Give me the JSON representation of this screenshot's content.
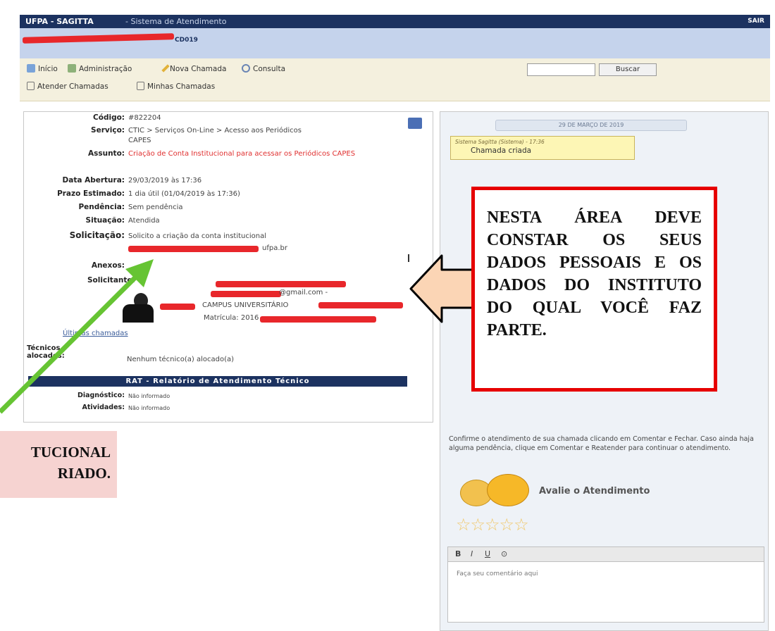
{
  "window": {
    "app_title": "UFPA - SAGITTA",
    "subtitle": "- Sistema de Atendimento",
    "right_label": "SAIR",
    "user_label": "CD019"
  },
  "toolbar": {
    "inicio": "Início",
    "administracao": "Administração",
    "nova_chamada": "Nova Chamada",
    "consulta": "Consulta",
    "atender_chamadas": "Atender Chamadas",
    "minhas_chamadas": "Minhas Chamadas",
    "search_value": "",
    "search_button": "Buscar"
  },
  "ticket": {
    "codigo_label": "Código:",
    "codigo_value": "#822204",
    "servico_label": "Serviço:",
    "servico_value": "CTIC > Serviços On-Line > Acesso aos Periódicos CAPES",
    "assunto_label": "Assunto:",
    "assunto_value": "Criação de Conta Institucional para acessar os Periódicos CAPES",
    "data_abertura_label": "Data Abertura:",
    "data_abertura_value": "29/03/2019 às 17:36",
    "prazo_label": "Prazo Estimado:",
    "prazo_value": "1 dia útil (01/04/2019 às 17:36)",
    "pendencia_label": "Pendência:",
    "pendencia_value": "Sem pendência",
    "situacao_label": "Situação:",
    "situacao_value": "Atendida",
    "solicitacao_label": "Solicitação:",
    "solicitacao_value": "Solicito a criação da conta institucional",
    "solicitacao_email_suffix": "ufpa.br",
    "anexos_label": "Anexos:",
    "solicitante_label": "Solicitante:",
    "solicitante_email_suffix": "@gmail.com -",
    "solicitante_campus": "CAMPUS UNIVERSITÁRIO",
    "solicitante_matricula": "Matrícula: 2016",
    "ultimas_chamadas": "Últimas chamadas",
    "tecnicos_label": "Técnicos alocados:",
    "tecnicos_value": "Nenhum técnico(a) alocado(a)",
    "rat_title": "RAT - Relatório de Atendimento Técnico",
    "diagnostico_label": "Diagnóstico:",
    "diagnostico_value": "Não informado",
    "atividades_label": "Atividades:",
    "atividades_value": "Não informado"
  },
  "history": {
    "date_button": "29 DE MARÇO DE 2019",
    "note_header": "Sistema Sagitta (Sistema) - 17:36",
    "note_text": "Chamada criada"
  },
  "confirm": {
    "text": "Confirme o atendimento de sua chamada clicando em Comentar e Fechar. Caso ainda haja alguma pendência, clique em Comentar e Reatender para continuar o atendimento.",
    "rate_label": "Avalie o Atendimento",
    "stars": "☆☆☆☆☆"
  },
  "editor": {
    "bold": "B",
    "italic": "I",
    "underline": "U",
    "extra": "⊙",
    "placeholder": "Faça seu comentário aqui"
  },
  "annotations": {
    "redbox_text": "NESTA ÁREA DEVE CONSTAR OS SEUS DADOS PESSOAIS E OS DADOS DO INSTITUTO DO QUAL VOCÊ FAZ PARTE.",
    "pink_line1": "TUCIONAL",
    "pink_line2": "RIADO."
  },
  "colors": {
    "titlebar": "#1c3260",
    "redact": "#e8272b",
    "annotation_red": "#e60000",
    "arrow_green": "#66c433",
    "arrow_fill": "#fbd5b5"
  }
}
